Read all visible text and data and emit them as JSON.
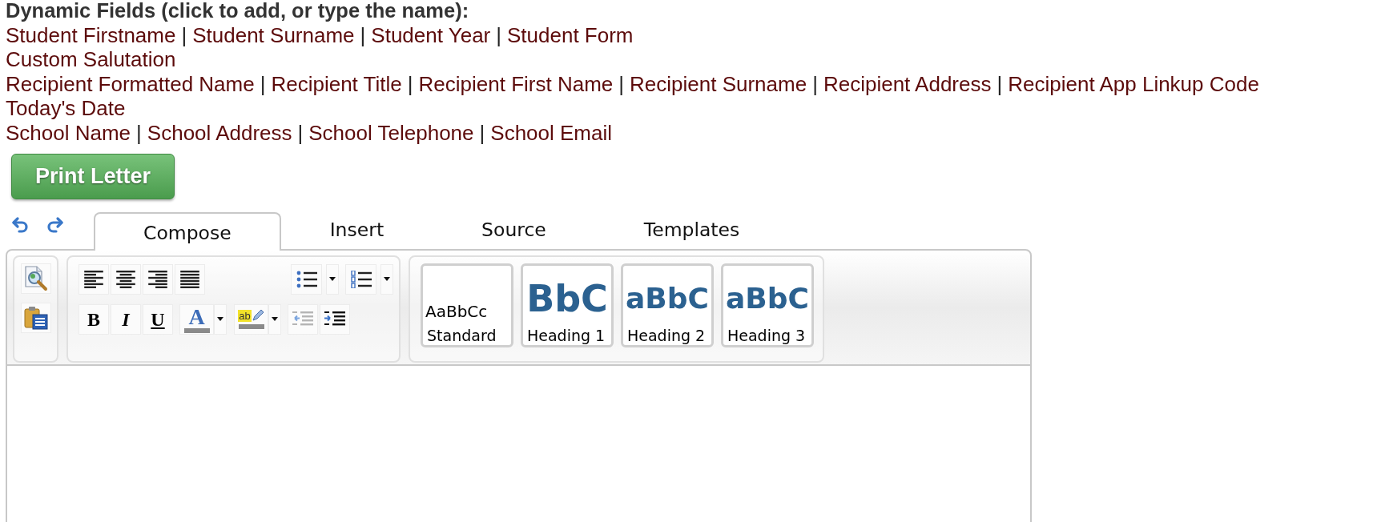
{
  "heading": "Dynamic Fields (click to add, or type the name):",
  "field_lines": [
    {
      "fields": [
        {
          "label": "Student Firstname"
        },
        {
          "separator": "|",
          "label": "Student Surname"
        },
        {
          "separator": "|",
          "label": "Student Year"
        },
        {
          "separator": "|",
          "label": "Student Form"
        }
      ]
    },
    {
      "fields": [
        {
          "label": "Custom Salutation"
        }
      ]
    },
    {
      "fields": [
        {
          "label": "Recipient Formatted Name"
        },
        {
          "separator": "|",
          "label": "Recipient Title"
        },
        {
          "separator": "|",
          "label": "Recipient First Name"
        },
        {
          "separator": "|",
          "label": "Recipient Surname"
        },
        {
          "separator": "|",
          "label": "Recipient Address"
        },
        {
          "separator": "|",
          "label": "Recipient App Linkup Code"
        }
      ]
    },
    {
      "fields": [
        {
          "label": "Today's Date"
        }
      ]
    },
    {
      "fields": [
        {
          "label": "School Name"
        },
        {
          "separator": "|",
          "label": "School Address"
        },
        {
          "separator": "|",
          "label": "School Telephone"
        },
        {
          "separator": "|",
          "label": "School Email"
        }
      ]
    }
  ],
  "print_button": {
    "label": "Print Letter"
  },
  "tabs": [
    {
      "label": "Compose",
      "selected": true
    },
    {
      "label": "Insert",
      "selected": false
    },
    {
      "label": "Source",
      "selected": false
    },
    {
      "label": "Templates",
      "selected": false
    }
  ],
  "toolbar": {
    "format_buttons": [
      {
        "kind": "bold",
        "glyph": "B"
      },
      {
        "kind": "italic",
        "glyph": "I"
      },
      {
        "kind": "underline",
        "glyph": "U"
      }
    ],
    "font_color_button": {
      "glyph": "A"
    },
    "highlight_button": {
      "glyph": "ab"
    }
  },
  "styles": [
    {
      "kind": "standard",
      "sample": "AaBbCc",
      "label": "Standard"
    },
    {
      "kind": "heading1",
      "sample": "BbC",
      "label": "Heading 1"
    },
    {
      "kind": "heading2",
      "sample": "aBbC",
      "label": "Heading 2"
    },
    {
      "kind": "heading3",
      "sample": "aBbC",
      "label": "Heading 3"
    }
  ]
}
